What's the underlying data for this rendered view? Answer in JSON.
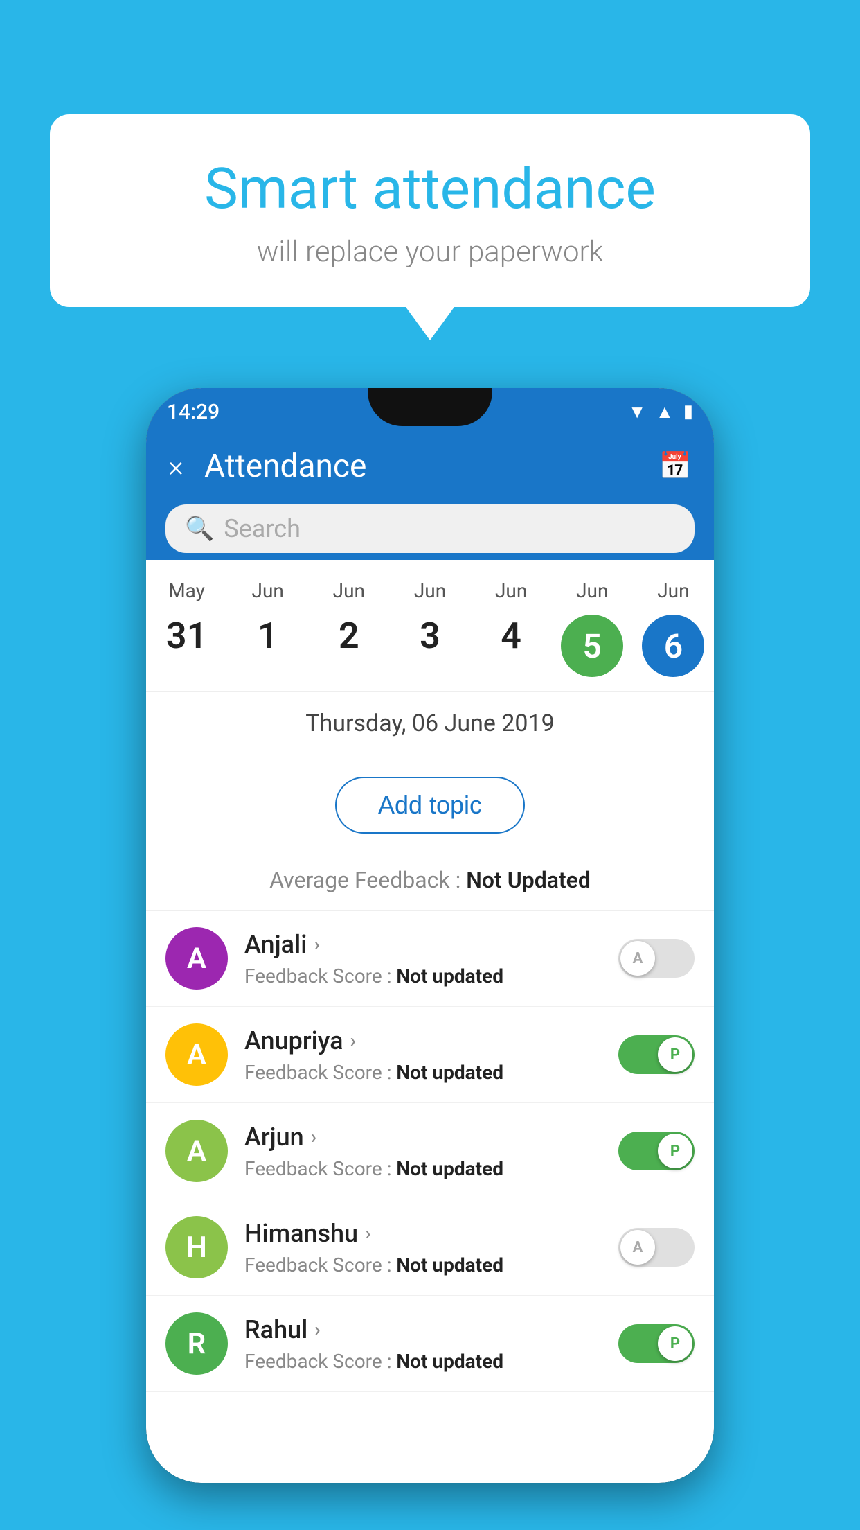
{
  "background_color": "#29B6E8",
  "speech_bubble": {
    "title": "Smart attendance",
    "subtitle": "will replace your paperwork"
  },
  "status_bar": {
    "time": "14:29",
    "icons": [
      "wifi",
      "signal",
      "battery"
    ]
  },
  "app_header": {
    "title": "Attendance",
    "close_icon": "×",
    "calendar_icon": "📅"
  },
  "search": {
    "placeholder": "Search"
  },
  "calendar": {
    "dates": [
      {
        "month": "May",
        "day": "31",
        "state": "normal"
      },
      {
        "month": "Jun",
        "day": "1",
        "state": "normal"
      },
      {
        "month": "Jun",
        "day": "2",
        "state": "normal"
      },
      {
        "month": "Jun",
        "day": "3",
        "state": "normal"
      },
      {
        "month": "Jun",
        "day": "4",
        "state": "normal"
      },
      {
        "month": "Jun",
        "day": "5",
        "state": "today"
      },
      {
        "month": "Jun",
        "day": "6",
        "state": "selected"
      }
    ]
  },
  "selected_date_label": "Thursday, 06 June 2019",
  "add_topic_label": "Add topic",
  "average_feedback": {
    "label": "Average Feedback : ",
    "value": "Not Updated"
  },
  "students": [
    {
      "name": "Anjali",
      "avatar_letter": "A",
      "avatar_color": "#9C27B0",
      "feedback_label": "Feedback Score : ",
      "feedback_value": "Not updated",
      "toggle_state": "off",
      "toggle_letter": "A"
    },
    {
      "name": "Anupriya",
      "avatar_letter": "A",
      "avatar_color": "#FFC107",
      "feedback_label": "Feedback Score : ",
      "feedback_value": "Not updated",
      "toggle_state": "on",
      "toggle_letter": "P"
    },
    {
      "name": "Arjun",
      "avatar_letter": "A",
      "avatar_color": "#8BC34A",
      "feedback_label": "Feedback Score : ",
      "feedback_value": "Not updated",
      "toggle_state": "on",
      "toggle_letter": "P"
    },
    {
      "name": "Himanshu",
      "avatar_letter": "H",
      "avatar_color": "#8BC34A",
      "feedback_label": "Feedback Score : ",
      "feedback_value": "Not updated",
      "toggle_state": "off",
      "toggle_letter": "A"
    },
    {
      "name": "Rahul",
      "avatar_letter": "R",
      "avatar_color": "#4CAF50",
      "feedback_label": "Feedback Score : ",
      "feedback_value": "Not updated",
      "toggle_state": "on",
      "toggle_letter": "P"
    }
  ]
}
